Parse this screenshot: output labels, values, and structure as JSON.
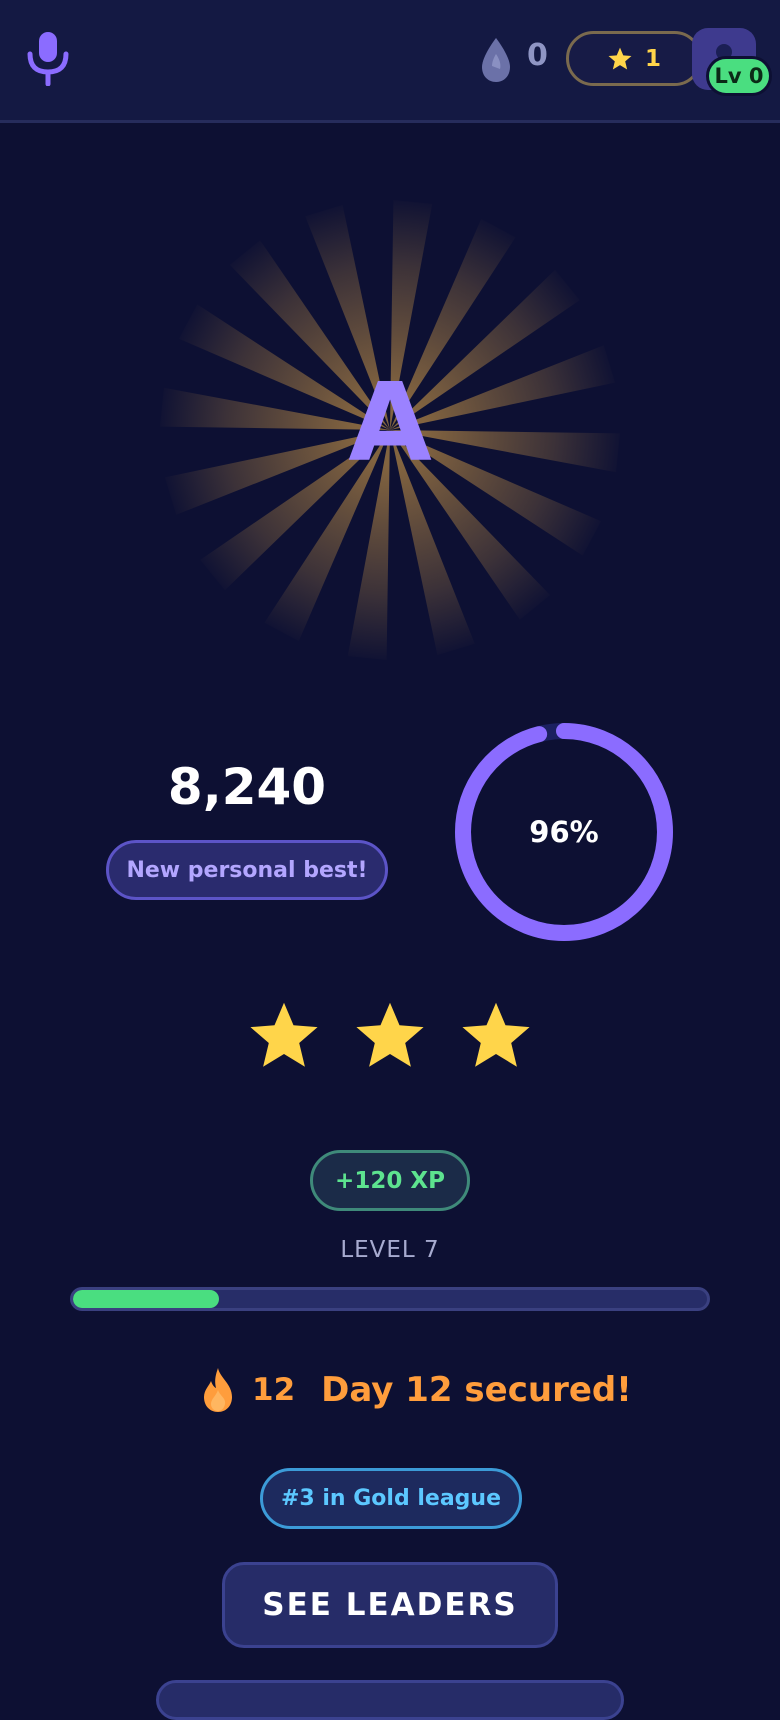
{
  "header": {
    "drop_count": "0",
    "stars_count": "1",
    "level_badge": "Lv 0"
  },
  "result": {
    "grade": "A",
    "score": "8,240",
    "personal_best": "New personal best!",
    "accuracy_label": "96%",
    "accuracy": 0.96,
    "stars_earned": 3,
    "stars_total": 3
  },
  "progress": {
    "xp_gain": "+120 XP",
    "level_label": "LEVEL 7",
    "level_progress": 0.23
  },
  "streak": {
    "count": "12",
    "message": "Day 12 secured!"
  },
  "league": {
    "rank": "#3 in Gold league"
  },
  "actions": {
    "leaders_label": "SEE LEADERS"
  },
  "colors": {
    "background": "#0d1033",
    "accent_purple": "#9b82ff",
    "star_gold": "#ffd54a",
    "xp_green": "#4ade80",
    "streak_orange": "#ff9d3c",
    "league_blue": "#5cc8ff"
  }
}
